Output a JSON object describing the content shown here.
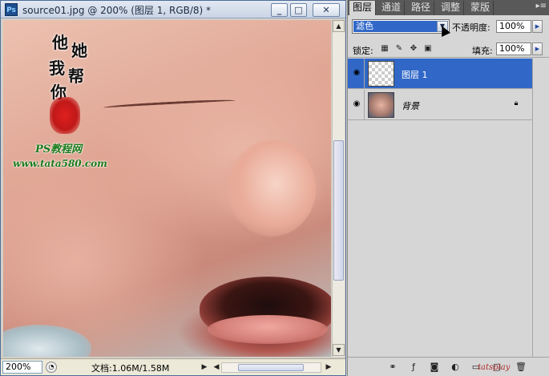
{
  "document": {
    "title": "source01.jpg @ 200% (图层 1, RGB/8) *",
    "app_icon": "Ps",
    "zoom": "200%",
    "doc_size": "文档:1.06M/1.58M",
    "controls": {
      "minimize": "_",
      "maximize": "□",
      "close": "✕"
    },
    "watermark": {
      "calligraphy": [
        "他",
        "她",
        "我",
        "帮",
        "你"
      ],
      "line1": "PS教程网",
      "line2": "www.tata580.com"
    }
  },
  "panel": {
    "tabs": [
      "图层",
      "通道",
      "路径",
      "调整",
      "蒙版"
    ],
    "menu_icon": "▸≡",
    "blend_mode": "滤色",
    "opacity_label": "不透明度:",
    "opacity_value": "100%",
    "lock_label": "锁定:",
    "fill_label": "填充:",
    "fill_value": "100%",
    "layers": [
      {
        "name": "图层 1",
        "selected": true,
        "visible": true,
        "thumb": "transparent"
      },
      {
        "name": "背景",
        "selected": false,
        "visible": true,
        "thumb": "photo",
        "locked": true
      }
    ],
    "footer_watermark": "tatsplay"
  }
}
